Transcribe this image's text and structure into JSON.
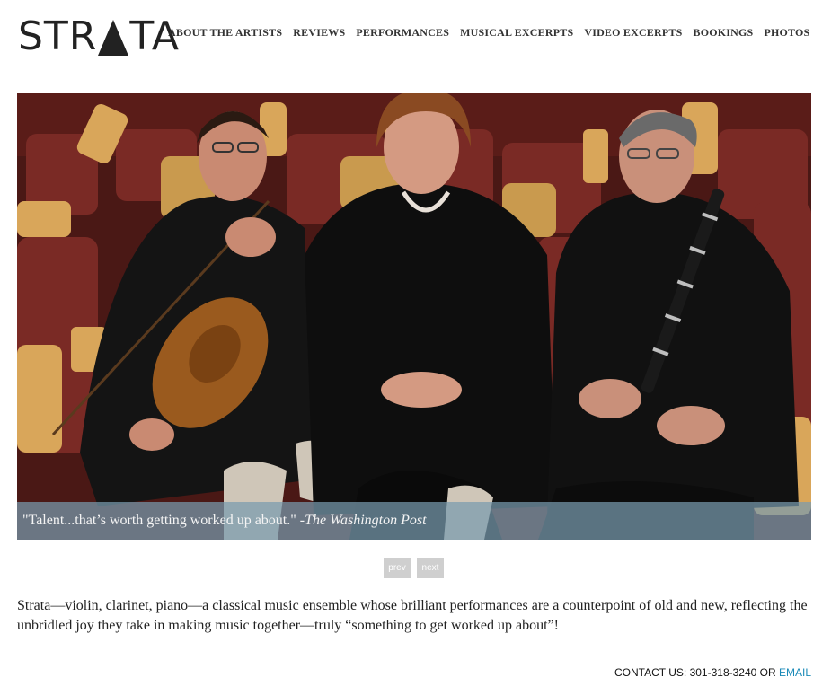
{
  "brand": {
    "logo_left": "STR",
    "logo_right": "TA"
  },
  "nav": {
    "items": [
      {
        "label": "ABOUT THE ARTISTS"
      },
      {
        "label": "REVIEWS"
      },
      {
        "label": "PERFORMANCES"
      },
      {
        "label": "MUSICAL EXCERPTS"
      },
      {
        "label": "VIDEO EXCERPTS"
      },
      {
        "label": "BOOKINGS"
      },
      {
        "label": "PHOTOS"
      }
    ]
  },
  "slideshow": {
    "quote": "\"Talent...that’s worth getting worked up about.\" -",
    "source": "The Washington Post",
    "prev_label": "prev",
    "next_label": "next"
  },
  "intro": {
    "text": "Strata—violin, clarinet, piano—a classical music ensemble whose brilliant performances are a counterpoint of old and new, reflecting the unbridled joy they take in making music together—truly “something to get worked up about”!"
  },
  "footer": {
    "contact_prefix": "CONTACT US: 301-318-3240 OR ",
    "email_label": "EMAIL"
  },
  "colors": {
    "caption_bar": "#789baf",
    "link": "#1a8ab8",
    "pager_button": "#cfcfcf",
    "seat_red": "#7a2a25",
    "seat_wood": "#d9a65a"
  }
}
